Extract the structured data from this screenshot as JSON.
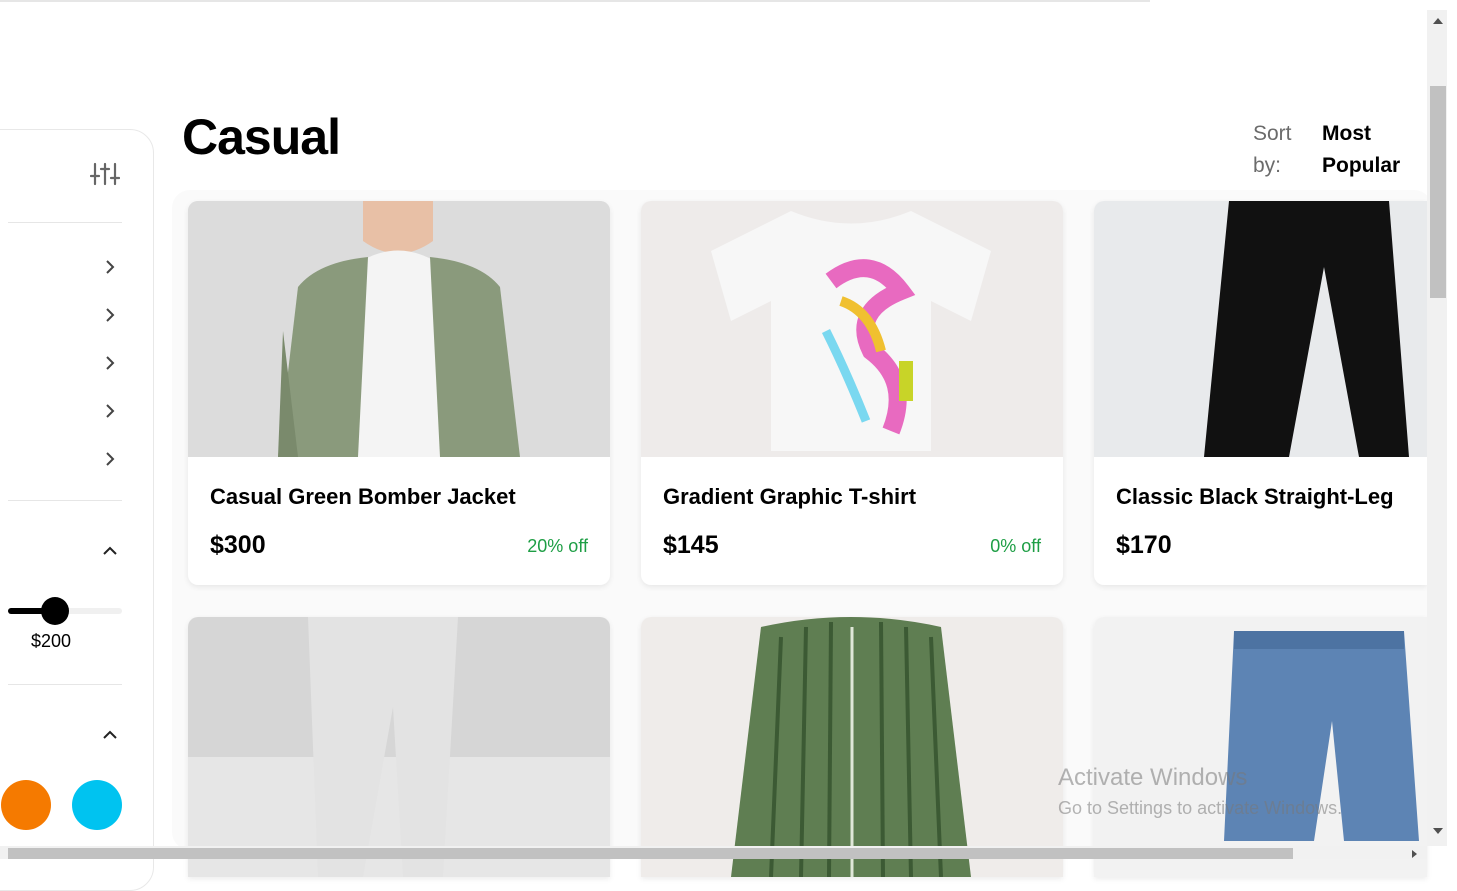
{
  "page": {
    "title": "Casual"
  },
  "sort": {
    "label": "Sort by:",
    "value": "Most Popular"
  },
  "sidebar": {
    "filter_icon": "sliders-icon",
    "category_chevrons": [
      "chevron-right-icon",
      "chevron-right-icon",
      "chevron-right-icon",
      "chevron-right-icon",
      "chevron-right-icon"
    ],
    "price": {
      "icon": "chevron-up-icon",
      "value_label": "$200"
    },
    "colors": {
      "icon": "chevron-up-icon",
      "swatches": [
        "#f57a00",
        "#00c3f0"
      ]
    }
  },
  "products": [
    {
      "name": "Casual Green Bomber Jacket",
      "price": "$300",
      "discount": "20% off"
    },
    {
      "name": "Gradient Graphic T-shirt",
      "price": "$145",
      "discount": "0% off"
    },
    {
      "name": "Classic Black Straight-Leg",
      "price": "$170",
      "discount": ""
    }
  ],
  "watermark": {
    "title": "Activate Windows",
    "subtitle": "Go to Settings to activate Windows."
  }
}
